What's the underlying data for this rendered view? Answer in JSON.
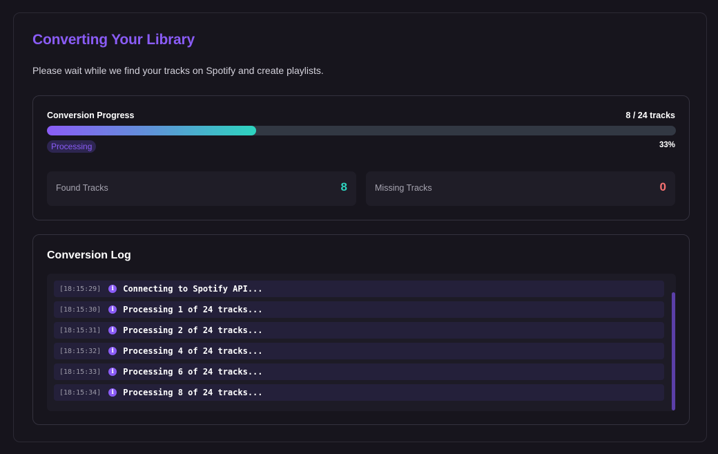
{
  "header": {
    "title": "Converting Your Library",
    "subtitle": "Please wait while we find your tracks on Spotify and create playlists."
  },
  "progress": {
    "label": "Conversion Progress",
    "count_text": "8 / 24 tracks",
    "fraction": 0.333,
    "percent_text": "33%",
    "status": "Processing"
  },
  "stats": {
    "found": {
      "label": "Found Tracks",
      "value": "8"
    },
    "missing": {
      "label": "Missing Tracks",
      "value": "0"
    }
  },
  "log": {
    "title": "Conversion Log",
    "icon": "info-icon",
    "entries": [
      {
        "time": "[18:15:29]",
        "message": "Connecting to Spotify API..."
      },
      {
        "time": "[18:15:30]",
        "message": "Processing 1 of 24 tracks..."
      },
      {
        "time": "[18:15:31]",
        "message": "Processing 2 of 24 tracks..."
      },
      {
        "time": "[18:15:32]",
        "message": "Processing 4 of 24 tracks..."
      },
      {
        "time": "[18:15:33]",
        "message": "Processing 6 of 24 tracks..."
      },
      {
        "time": "[18:15:34]",
        "message": "Processing 8 of 24 tracks..."
      }
    ]
  },
  "colors": {
    "accent": "#8a5cf6",
    "found": "#2dd4bf",
    "missing": "#f87171"
  }
}
